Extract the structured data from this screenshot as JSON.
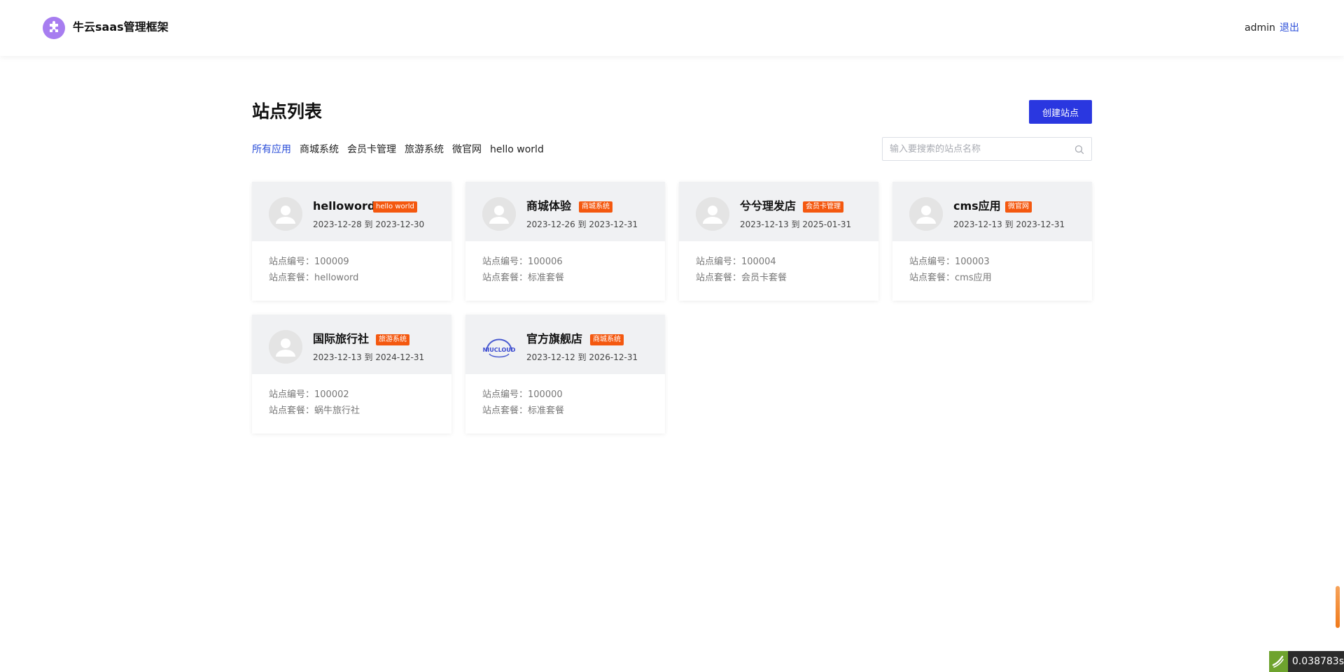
{
  "app": {
    "title": "牛云saas管理框架",
    "user": "admin",
    "logout_label": "退出",
    "brand_color": "#a77df0",
    "accent_color": "#2a37e0",
    "tag_color": "#f4580f"
  },
  "main": {
    "title": "站点列表",
    "create_label": "创建站点",
    "filters": [
      "所有应用",
      "商城系统",
      "会员卡管理",
      "旅游系统",
      "微官网",
      "hello world"
    ],
    "active_filter": "所有应用",
    "search": {
      "placeholder": "输入要搜索的站点名称",
      "value": ""
    }
  },
  "sites": [
    {
      "name": "helloword",
      "tag": "hello world",
      "date": "2023-12-28 到 2023-12-30",
      "id_label": "站点编号：",
      "id": "100009",
      "pkg_label": "站点套餐：",
      "package": "helloword",
      "avatar": "default-avatar"
    },
    {
      "name": "商城体验",
      "tag": "商城系统",
      "date": "2023-12-26 到 2023-12-31",
      "id_label": "站点编号：",
      "id": "100006",
      "pkg_label": "站点套餐：",
      "package": "标准套餐",
      "avatar": "default-avatar"
    },
    {
      "name": "兮兮理发店",
      "tag": "会员卡管理",
      "date": "2023-12-13 到 2025-01-31",
      "id_label": "站点编号：",
      "id": "100004",
      "pkg_label": "站点套餐：",
      "package": "会员卡套餐",
      "avatar": "default-avatar"
    },
    {
      "name": "cms应用",
      "tag": "微官网",
      "date": "2023-12-13 到 2023-12-31",
      "id_label": "站点编号：",
      "id": "100003",
      "pkg_label": "站点套餐：",
      "package": "cms应用",
      "avatar": "default-avatar"
    },
    {
      "name": "国际旅行社",
      "tag": "旅游系统",
      "date": "2023-12-13 到 2024-12-31",
      "id_label": "站点编号：",
      "id": "100002",
      "pkg_label": "站点套餐：",
      "package": "蜗牛旅行社",
      "avatar": "default-avatar"
    },
    {
      "name": "官方旗舰店",
      "tag": "商城系统",
      "date": "2023-12-12 到 2026-12-31",
      "id_label": "站点编号：",
      "id": "100000",
      "pkg_label": "站点套餐：",
      "package": "标准套餐",
      "avatar": "niucloud-logo",
      "logo_text": "NIUCLOUD"
    }
  ],
  "debug": {
    "time": "0.038783s"
  }
}
